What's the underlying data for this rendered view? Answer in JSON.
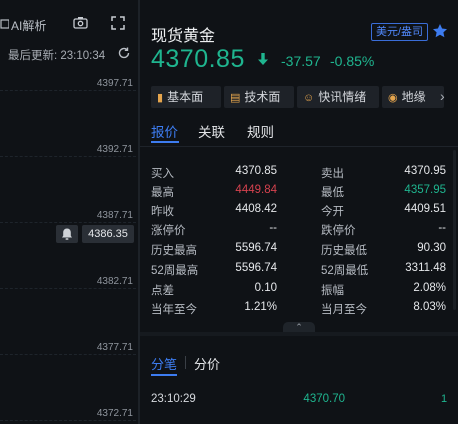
{
  "chart_panel": {
    "toolbar": {
      "ai_label": "AI解析",
      "camera_icon": "camera-icon",
      "fullscreen_icon": "expand-icon"
    },
    "last_update": "最后更新: 23:10:34",
    "price_ticks": [
      "4397.71",
      "4392.71",
      "4387.71",
      "4382.71",
      "4377.71",
      "4372.71"
    ],
    "current_price": "4386.35"
  },
  "quote": {
    "name": "现货黄金",
    "currency": "美元/盎司",
    "last_price": "4370.85",
    "change_abs": "-37.57",
    "change_pct": "-0.85%",
    "colors": {
      "down": "#1fb58f",
      "up": "#d6424f",
      "accent": "#3d7cf0"
    }
  },
  "chips": [
    {
      "label": "基本面",
      "icon": "document-icon"
    },
    {
      "label": "技术面",
      "icon": "bar-chart-icon"
    },
    {
      "label": "快讯情绪",
      "icon": "smile-icon"
    },
    {
      "label": "地缘",
      "icon": "globe-icon"
    }
  ],
  "tabs": [
    "报价",
    "关联",
    "规则"
  ],
  "stats": {
    "left": [
      {
        "label": "买入",
        "value": "4370.85"
      },
      {
        "label": "最高",
        "value": "4449.84"
      },
      {
        "label": "昨收",
        "value": "4408.42"
      },
      {
        "label": "涨停价",
        "value": "--"
      },
      {
        "label": "历史最高",
        "value": "5596.74"
      },
      {
        "label": "52周最高",
        "value": "5596.74"
      },
      {
        "label": "点差",
        "value": "0.10"
      },
      {
        "label": "当年至今",
        "value": "1.21%"
      }
    ],
    "right": [
      {
        "label": "卖出",
        "value": "4370.95"
      },
      {
        "label": "最低",
        "value": "4357.95"
      },
      {
        "label": "今开",
        "value": "4409.51"
      },
      {
        "label": "跌停价",
        "value": "--"
      },
      {
        "label": "历史最低",
        "value": "90.30"
      },
      {
        "label": "52周最低",
        "value": "3311.48"
      },
      {
        "label": "振幅",
        "value": "2.08%"
      },
      {
        "label": "当月至今",
        "value": "8.03%"
      }
    ]
  },
  "trade_tabs": [
    "分笔",
    "分价"
  ],
  "trades": [
    {
      "time": "23:10:29",
      "price": "4370.70",
      "flag": "1"
    }
  ]
}
